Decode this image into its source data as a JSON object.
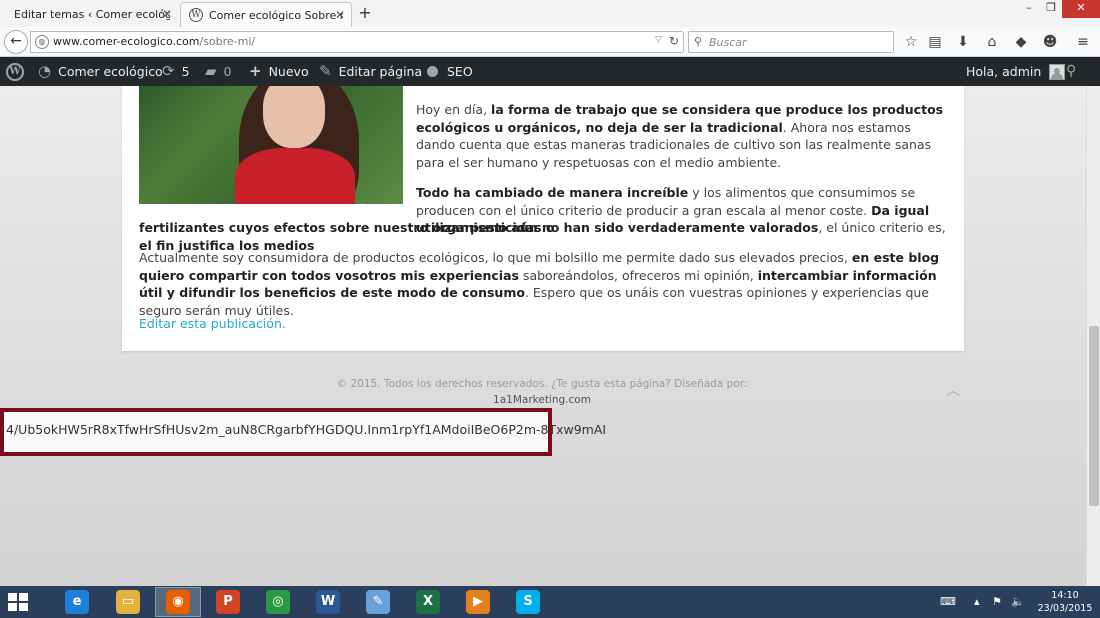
{
  "browser": {
    "tabs": [
      {
        "label": "Editar temas ‹ Comer ecológ...",
        "active": false
      },
      {
        "label": "Comer ecológico Sobre mí...",
        "active": true
      }
    ],
    "new_tab_label": "+",
    "window_controls": {
      "minimize": "–",
      "maximize": "❐",
      "close": "✕"
    },
    "address": {
      "host": "www.comer-ecologico.com",
      "path": "/sobre-mi/"
    },
    "search_placeholder": "Buscar",
    "icons": [
      "back-icon",
      "globe-icon",
      "reload-icon",
      "search-icon",
      "star-icon",
      "reading-list-icon",
      "download-icon",
      "home-icon",
      "pocket-icon",
      "chat-icon",
      "menu-icon"
    ]
  },
  "adminbar": {
    "site_name": "Comer ecológico",
    "updates_count": "5",
    "comments_count": "0",
    "new_label": "Nuevo",
    "edit_label": "Editar página",
    "seo_label": "SEO",
    "greeting": "Hola, admin"
  },
  "article": {
    "p1_a": "Hoy en día, ",
    "p1_b": "la forma de trabajo que se considera que produce los productos ecológicos u orgánicos, no deja de ser la tradicional",
    "p1_c": ". Ahora nos estamos dando cuenta que estas maneras tradicionales de cultivo son las realmente sanas para el ser humano y respetuosas con el medio ambiente.",
    "p2_a": "Todo ha cambiado de manera increíble",
    "p2_b": " y los alimentos que consumimos se producen con el único criterio de producir a gran escala al menor coste. ",
    "p2_c": "Da igual utilizar pesticidas o",
    "p2d": "fertilizantes cuyos efectos sobre nuestro organismo aún no han sido verdaderamente valorados",
    "p2e": ", el único criterio es, ",
    "p2f": "el fin justifica los medios",
    "p3_a": "Actualmente soy consumidora de productos ecológicos, lo que mi bolsillo me permite dado sus elevados precios, ",
    "p3_b": "en este blog quiero compartir con todos vosotros mis experiencias",
    "p3_c": " saboreándolos, ofreceros mi opinión, ",
    "p3_d": "intercambiar información útil y difundir los beneficios de este modo de consumo",
    "p3_e": ". Espero que os unáis con vuestras opiniones y experiencias que seguro serán muy útiles.",
    "edit_link": "Editar esta publicación."
  },
  "footer": {
    "copyright": "© 2015. Todos los derechos reservados. ¿Te gusta esta página? Diseñada por:",
    "brand": "1a1Marketing.com"
  },
  "token": {
    "text": "4/Ub5okHW5rR8xTfwHrSfHUsv2m_auN8CRgarbfYHGDQU.Inm1rpYf1AMdoiIBeO6P2m-8Txw9mAI",
    "border_color": "#7a0d1b"
  },
  "taskbar": {
    "apps": [
      {
        "name": "internet-explorer",
        "glyph": "e",
        "color": "#1e7fd6"
      },
      {
        "name": "file-explorer",
        "glyph": "▭",
        "color": "#e3b341"
      },
      {
        "name": "firefox",
        "glyph": "◉",
        "color": "#e66000"
      },
      {
        "name": "powerpoint",
        "glyph": "P",
        "color": "#d04423"
      },
      {
        "name": "chrome",
        "glyph": "◎",
        "color": "#2a9b44"
      },
      {
        "name": "word",
        "glyph": "W",
        "color": "#2b5797"
      },
      {
        "name": "paint",
        "glyph": "✎",
        "color": "#6aa0d8"
      },
      {
        "name": "excel",
        "glyph": "X",
        "color": "#1e7145"
      },
      {
        "name": "media-player",
        "glyph": "▶",
        "color": "#e4801e"
      },
      {
        "name": "skype",
        "glyph": "S",
        "color": "#00aff0"
      }
    ],
    "time": "14:10",
    "date": "23/03/2015"
  },
  "colors": {
    "adminbar_bg": "#23282d",
    "link": "#27a5d6",
    "taskbar_bg": "#2a3f5c"
  }
}
